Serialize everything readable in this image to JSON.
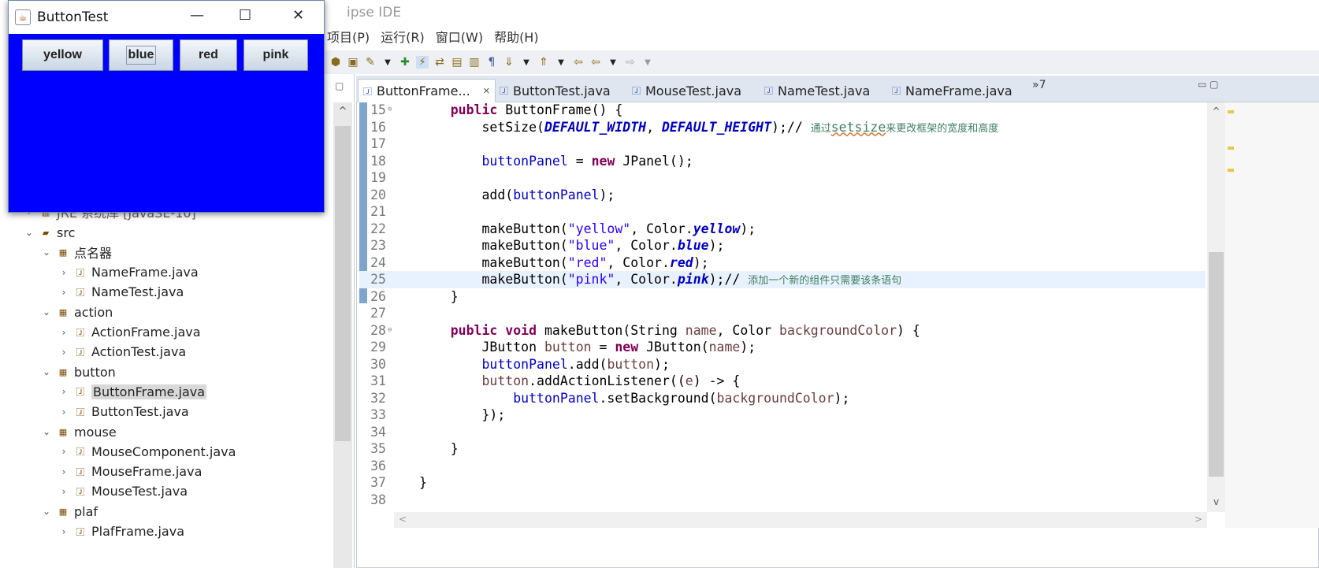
{
  "ide": {
    "title_visible": "ipse IDE",
    "menu": [
      "项目(P)",
      "运行(R)",
      "窗口(W)",
      "帮助(H)"
    ]
  },
  "swing": {
    "title": "ButtonTest",
    "background": "#0000ff",
    "buttons": [
      "yellow",
      "blue",
      "red",
      "pink"
    ],
    "focused": "blue"
  },
  "tree": {
    "partial_row": "JRE 系统库 [JavaSE-10]",
    "rows": [
      {
        "label": "src",
        "level": 0,
        "type": "source-folder",
        "expanded": true
      },
      {
        "label": "点名器",
        "level": 1,
        "type": "package",
        "expanded": true
      },
      {
        "label": "NameFrame.java",
        "level": 2,
        "type": "java-file"
      },
      {
        "label": "NameTest.java",
        "level": 2,
        "type": "java-file"
      },
      {
        "label": "action",
        "level": 1,
        "type": "package",
        "expanded": true
      },
      {
        "label": "ActionFrame.java",
        "level": 2,
        "type": "java-file"
      },
      {
        "label": "ActionTest.java",
        "level": 2,
        "type": "java-file"
      },
      {
        "label": "button",
        "level": 1,
        "type": "package",
        "expanded": true
      },
      {
        "label": "ButtonFrame.java",
        "level": 2,
        "type": "java-file",
        "selected": true
      },
      {
        "label": "ButtonTest.java",
        "level": 2,
        "type": "java-file"
      },
      {
        "label": "mouse",
        "level": 1,
        "type": "package",
        "expanded": true
      },
      {
        "label": "MouseComponent.java",
        "level": 2,
        "type": "java-file"
      },
      {
        "label": "MouseFrame.java",
        "level": 2,
        "type": "java-file"
      },
      {
        "label": "MouseTest.java",
        "level": 2,
        "type": "java-file"
      },
      {
        "label": "plaf",
        "level": 1,
        "type": "package",
        "expanded": true
      },
      {
        "label": "PlafFrame.java",
        "level": 2,
        "type": "java-file"
      }
    ]
  },
  "editor": {
    "tabs": [
      {
        "label": "ButtonFrame...",
        "active": true
      },
      {
        "label": "ButtonTest.java"
      },
      {
        "label": "MouseTest.java"
      },
      {
        "label": "NameTest.java"
      },
      {
        "label": "NameFrame.java"
      }
    ],
    "more_tabs": "»7",
    "current_line": 25,
    "lines": [
      {
        "n": "15",
        "fold": true,
        "t": [
          [
            "    ",
            "pl"
          ],
          [
            "public",
            "kw"
          ],
          [
            " ButtonFrame() {",
            "pl"
          ]
        ]
      },
      {
        "n": "16",
        "t": [
          [
            "        setSize(",
            "pl"
          ],
          [
            "DEFAULT_WIDTH",
            "st"
          ],
          [
            ", ",
            "pl"
          ],
          [
            "DEFAULT_HEIGHT",
            "st"
          ],
          [
            ");// ",
            "pl"
          ],
          [
            "通过",
            "cm"
          ],
          [
            "setsize",
            "cmu"
          ],
          [
            "来更改框架的宽度和高度",
            "cm"
          ]
        ]
      },
      {
        "n": "17",
        "t": []
      },
      {
        "n": "18",
        "t": [
          [
            "        ",
            "pl"
          ],
          [
            "buttonPanel",
            "fld"
          ],
          [
            " = ",
            "pl"
          ],
          [
            "new",
            "kw"
          ],
          [
            " JPanel();",
            "pl"
          ]
        ]
      },
      {
        "n": "19",
        "t": []
      },
      {
        "n": "20",
        "t": [
          [
            "        add(",
            "pl"
          ],
          [
            "buttonPanel",
            "fld"
          ],
          [
            ");",
            "pl"
          ]
        ]
      },
      {
        "n": "21",
        "t": []
      },
      {
        "n": "22",
        "t": [
          [
            "        makeButton(",
            "pl"
          ],
          [
            "\"yellow\"",
            "str"
          ],
          [
            ", Color.",
            "pl"
          ],
          [
            "yellow",
            "st"
          ],
          [
            ");",
            "pl"
          ]
        ]
      },
      {
        "n": "23",
        "t": [
          [
            "        makeButton(",
            "pl"
          ],
          [
            "\"blue\"",
            "str"
          ],
          [
            ", Color.",
            "pl"
          ],
          [
            "blue",
            "st"
          ],
          [
            ");",
            "pl"
          ]
        ]
      },
      {
        "n": "24",
        "t": [
          [
            "        makeButton(",
            "pl"
          ],
          [
            "\"red\"",
            "str"
          ],
          [
            ", Color.",
            "pl"
          ],
          [
            "red",
            "st"
          ],
          [
            ");",
            "pl"
          ]
        ]
      },
      {
        "n": "25",
        "t": [
          [
            "        makeButton(",
            "pl"
          ],
          [
            "\"pink\"",
            "str"
          ],
          [
            ", Color.",
            "pl"
          ],
          [
            "pink",
            "st"
          ],
          [
            ");// ",
            "pl"
          ],
          [
            "添加一个新的组件只需要该条语句",
            "cm"
          ]
        ]
      },
      {
        "n": "26",
        "t": [
          [
            "    }",
            "pl"
          ]
        ]
      },
      {
        "n": "27",
        "t": []
      },
      {
        "n": "28",
        "fold": true,
        "t": [
          [
            "    ",
            "pl"
          ],
          [
            "public",
            "kw"
          ],
          [
            " ",
            "pl"
          ],
          [
            "void",
            "kw"
          ],
          [
            " makeButton(String ",
            "pl"
          ],
          [
            "name",
            "var"
          ],
          [
            ", Color ",
            "pl"
          ],
          [
            "backgroundColor",
            "var"
          ],
          [
            ") {",
            "pl"
          ]
        ]
      },
      {
        "n": "29",
        "t": [
          [
            "        JButton ",
            "pl"
          ],
          [
            "button",
            "var"
          ],
          [
            " = ",
            "pl"
          ],
          [
            "new",
            "kw"
          ],
          [
            " JButton(",
            "pl"
          ],
          [
            "name",
            "var"
          ],
          [
            ");",
            "pl"
          ]
        ]
      },
      {
        "n": "30",
        "t": [
          [
            "        ",
            "pl"
          ],
          [
            "buttonPanel",
            "fld"
          ],
          [
            ".add(",
            "pl"
          ],
          [
            "button",
            "var"
          ],
          [
            ");",
            "pl"
          ]
        ]
      },
      {
        "n": "31",
        "t": [
          [
            "        ",
            "pl"
          ],
          [
            "button",
            "var"
          ],
          [
            ".addActionListener((",
            "pl"
          ],
          [
            "e",
            "var"
          ],
          [
            ") -> {",
            "pl"
          ]
        ]
      },
      {
        "n": "32",
        "t": [
          [
            "            ",
            "pl"
          ],
          [
            "buttonPanel",
            "fld"
          ],
          [
            ".setBackground(",
            "pl"
          ],
          [
            "backgroundColor",
            "var"
          ],
          [
            ");",
            "pl"
          ]
        ]
      },
      {
        "n": "33",
        "t": [
          [
            "        });",
            "pl"
          ]
        ]
      },
      {
        "n": "34",
        "t": []
      },
      {
        "n": "35",
        "t": [
          [
            "    }",
            "pl"
          ]
        ]
      },
      {
        "n": "36",
        "t": []
      },
      {
        "n": "37",
        "t": [
          [
            "}",
            "pl"
          ]
        ]
      },
      {
        "n": "38",
        "t": []
      }
    ]
  },
  "colors": {
    "keyword": "#7f0055",
    "field": "#0000c0",
    "string": "#2a00ff",
    "comment": "#3f7f5f",
    "current_line": "#e8f2fe"
  }
}
